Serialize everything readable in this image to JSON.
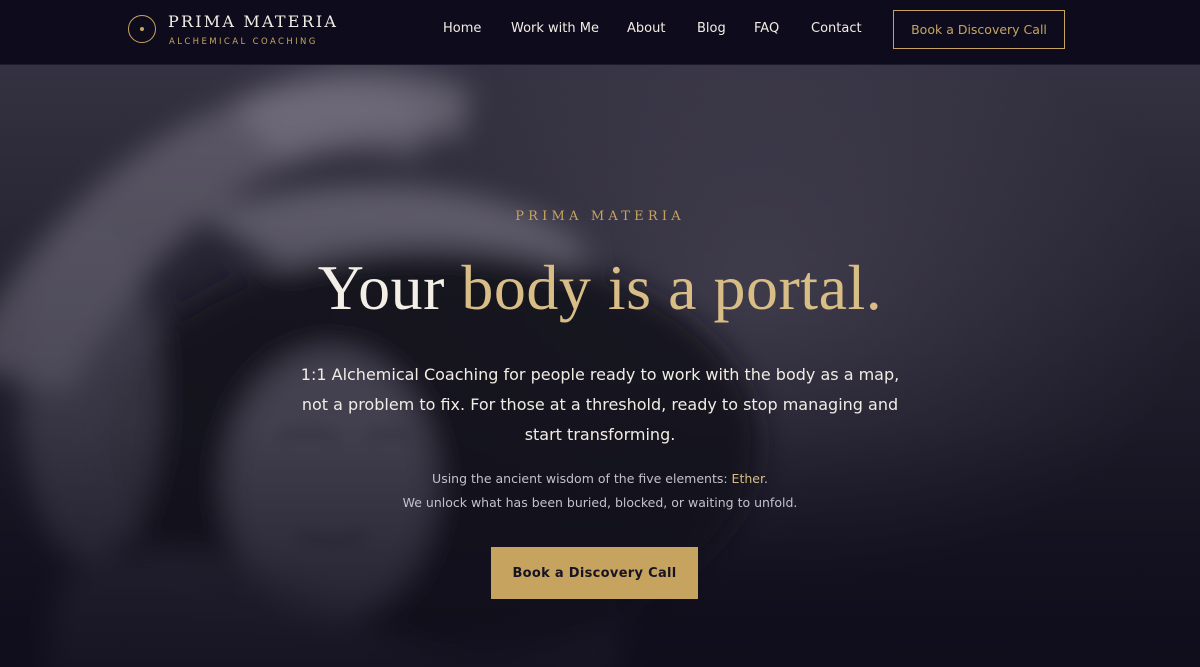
{
  "brand": {
    "name": "PRIMA MATERIA",
    "tagline": "ALCHEMICAL COACHING",
    "logo_icon": "circle-dot-icon"
  },
  "nav": {
    "items": [
      {
        "label": "Home"
      },
      {
        "label": "Work with Me"
      },
      {
        "label": "About"
      },
      {
        "label": "Blog"
      },
      {
        "label": "FAQ"
      },
      {
        "label": "Contact"
      }
    ],
    "cta_label": "Book a Discovery Call"
  },
  "hero": {
    "eyebrow": "PRIMA MATERIA",
    "headline_start": "Your ",
    "headline_accent": "body is a portal.",
    "lead": "1:1 Alchemical Coaching for people ready to work with the body as a map, not a problem to fix. For those at a threshold, ready to stop managing and start transforming.",
    "elements_prefix": "Using the ancient wisdom of the five elements: ",
    "elements_highlight": "Ether",
    "elements_suffix": ".",
    "unlock": "We unlock what has been buried, blocked, or waiting to unfold.",
    "cta_label": "Book a Discovery Call",
    "background_image": "blurred monochrome portrait photo"
  },
  "colors": {
    "background": "#0e0c1c",
    "gold": "#c6a45f",
    "gold_light": "#d8bd86",
    "text": "#f1ece4",
    "muted_text": "#c4bfcc"
  }
}
